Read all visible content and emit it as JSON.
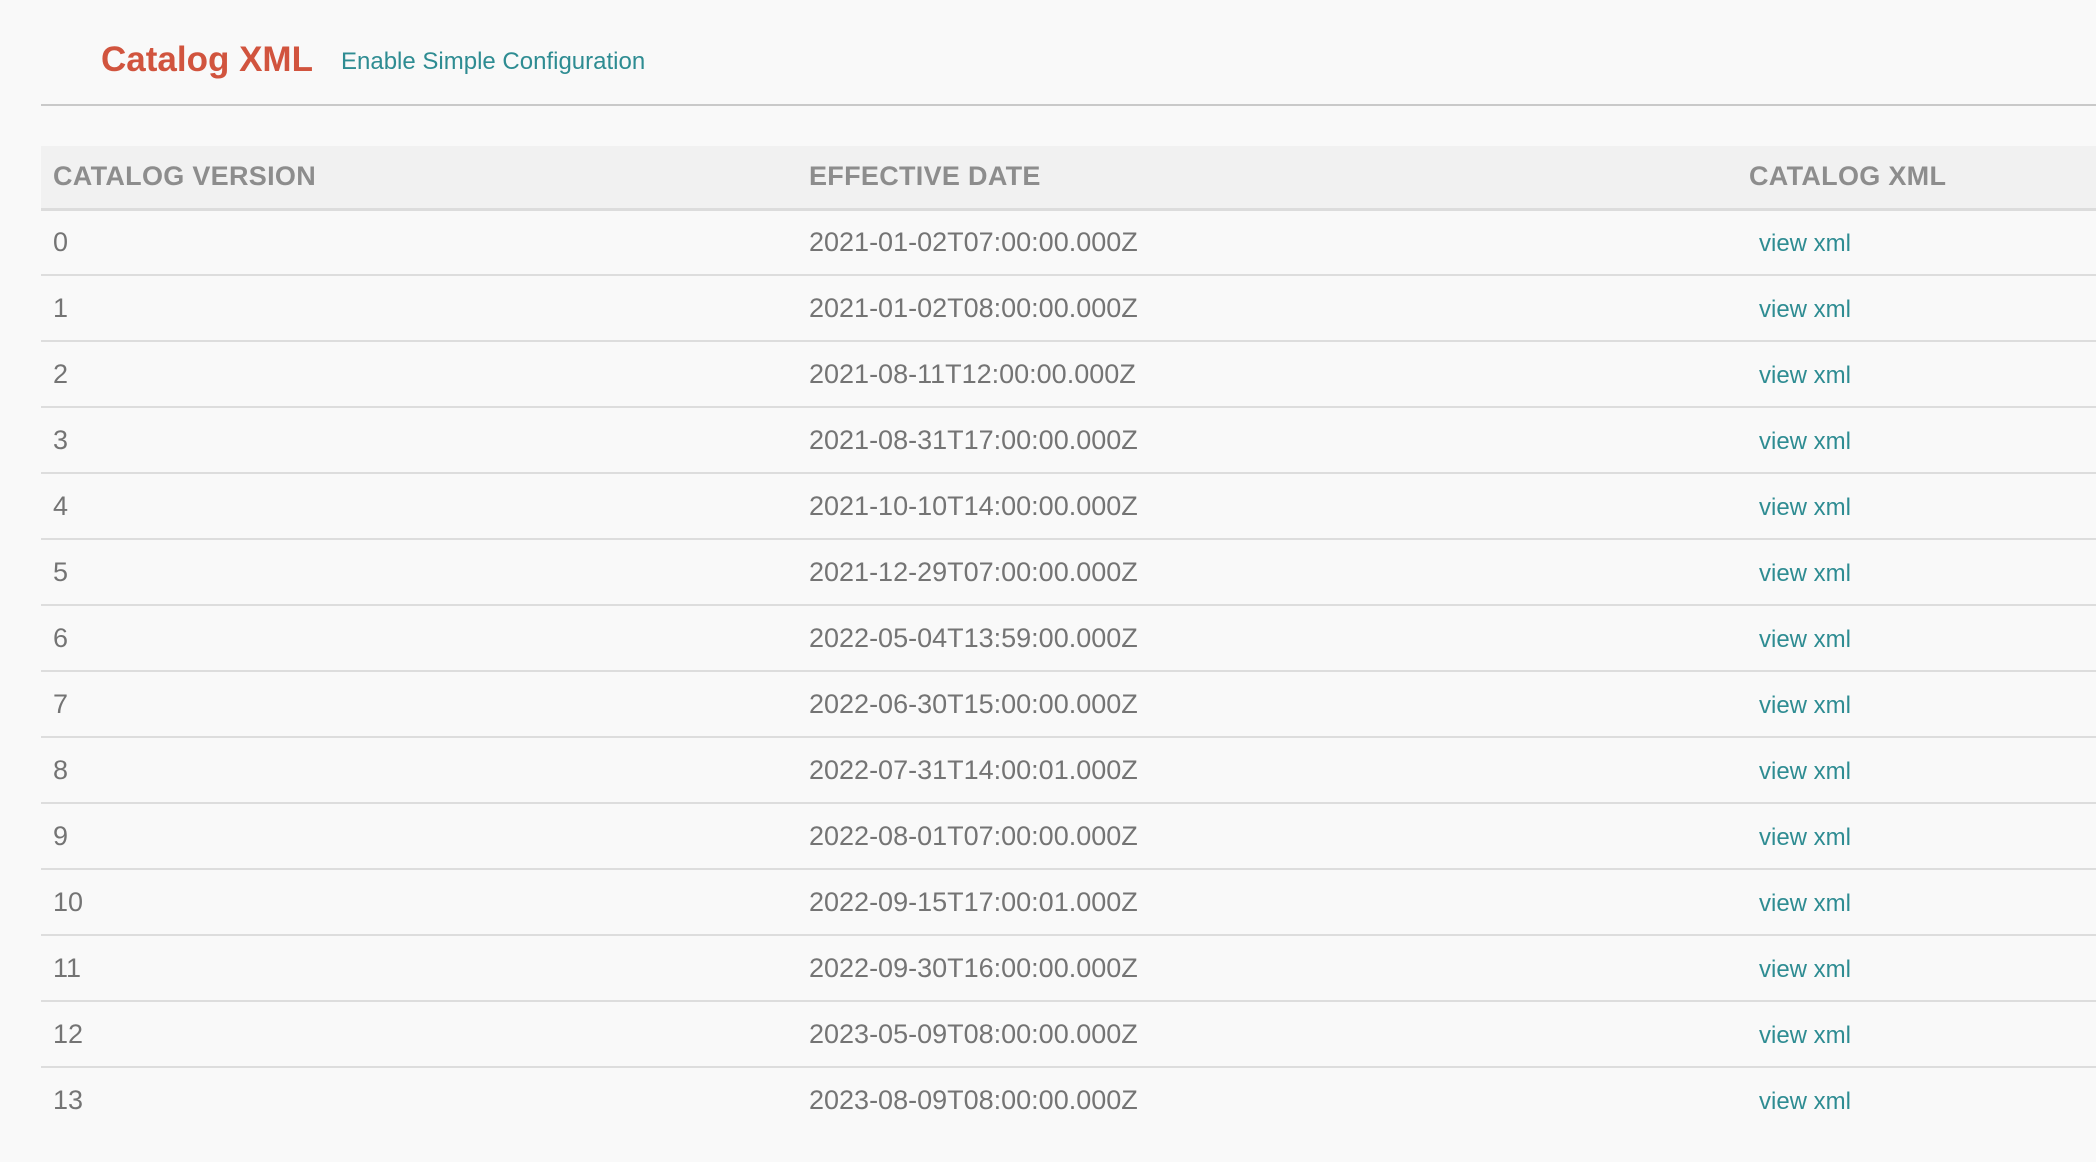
{
  "header": {
    "title": "Catalog XML",
    "enable_link": "Enable Simple Configuration"
  },
  "table": {
    "columns": [
      "CATALOG VERSION",
      "EFFECTIVE DATE",
      "CATALOG XML"
    ],
    "rows": [
      {
        "version": "0",
        "date": "2021-01-02T07:00:00.000Z",
        "link": "view xml"
      },
      {
        "version": "1",
        "date": "2021-01-02T08:00:00.000Z",
        "link": "view xml"
      },
      {
        "version": "2",
        "date": "2021-08-11T12:00:00.000Z",
        "link": "view xml"
      },
      {
        "version": "3",
        "date": "2021-08-31T17:00:00.000Z",
        "link": "view xml"
      },
      {
        "version": "4",
        "date": "2021-10-10T14:00:00.000Z",
        "link": "view xml"
      },
      {
        "version": "5",
        "date": "2021-12-29T07:00:00.000Z",
        "link": "view xml"
      },
      {
        "version": "6",
        "date": "2022-05-04T13:59:00.000Z",
        "link": "view xml"
      },
      {
        "version": "7",
        "date": "2022-06-30T15:00:00.000Z",
        "link": "view xml"
      },
      {
        "version": "8",
        "date": "2022-07-31T14:00:01.000Z",
        "link": "view xml"
      },
      {
        "version": "9",
        "date": "2022-08-01T07:00:00.000Z",
        "link": "view xml"
      },
      {
        "version": "10",
        "date": "2022-09-15T17:00:01.000Z",
        "link": "view xml"
      },
      {
        "version": "11",
        "date": "2022-09-30T16:00:00.000Z",
        "link": "view xml"
      },
      {
        "version": "12",
        "date": "2023-05-09T08:00:00.000Z",
        "link": "view xml"
      },
      {
        "version": "13",
        "date": "2023-08-09T08:00:00.000Z",
        "link": "view xml"
      }
    ]
  },
  "colors": {
    "title": "#d1543e",
    "link": "#2e8c92",
    "header_text": "#8d8d8d",
    "body_text": "#747474"
  }
}
